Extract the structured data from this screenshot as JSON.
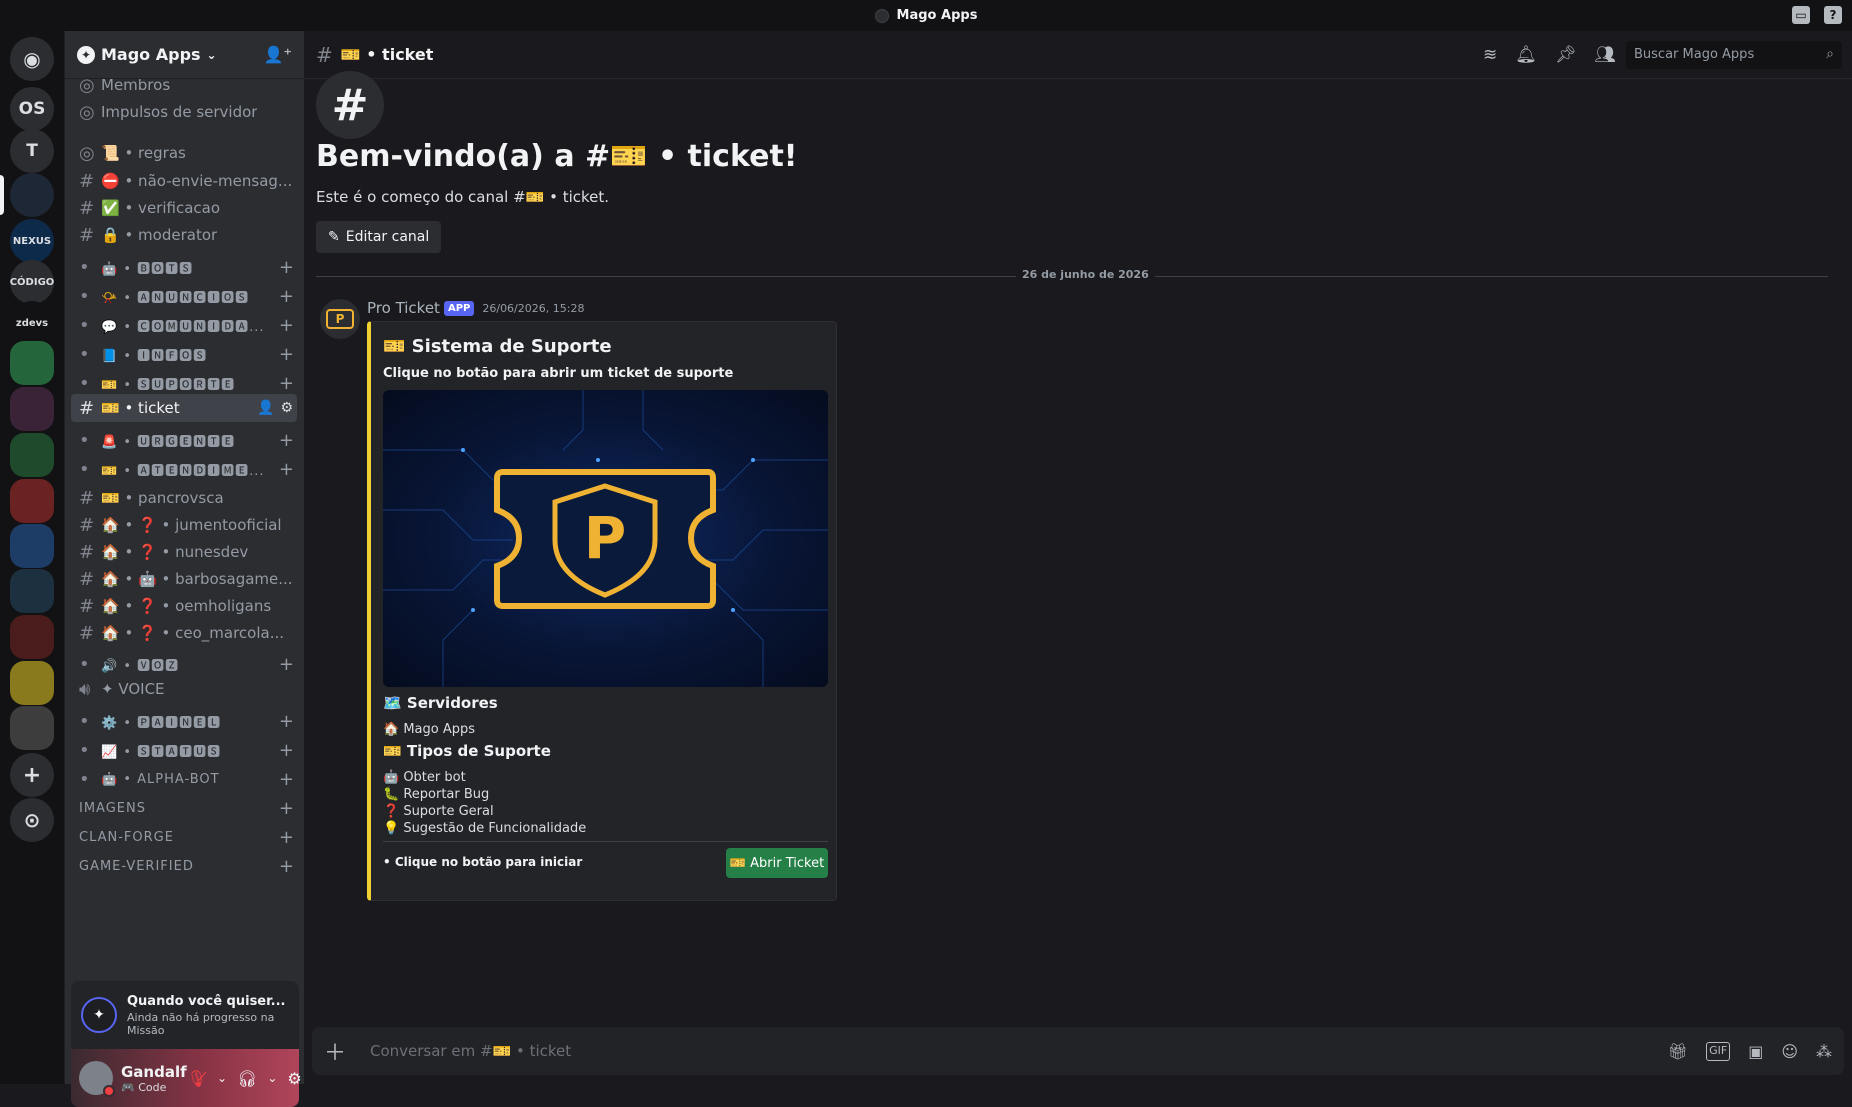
{
  "app": {
    "title": "Mago Apps"
  },
  "servers": {
    "items": [
      {
        "label": "",
        "kind": "home",
        "icon": "discord-logo-icon"
      },
      {
        "label": "OS"
      },
      {
        "label": "T"
      },
      {
        "label": "",
        "icon": "server-avatar",
        "selected": true
      },
      {
        "label": "NEXUS",
        "icon": "server-avatar"
      },
      {
        "label": "CÓDIGO",
        "icon": "server-avatar"
      },
      {
        "label": "zdevs",
        "icon": "server-avatar"
      },
      {
        "label": "",
        "icon": "server-folder"
      },
      {
        "label": "",
        "icon": "server-folder"
      },
      {
        "label": "",
        "icon": "server-folder"
      },
      {
        "label": "",
        "icon": "server-folder"
      },
      {
        "label": "",
        "icon": "server-folder"
      },
      {
        "label": "",
        "icon": "server-folder"
      },
      {
        "label": "",
        "icon": "server-folder"
      },
      {
        "label": "",
        "icon": "server-folder"
      },
      {
        "label": "",
        "icon": "server-folder"
      }
    ],
    "add_label": "+",
    "discover_label": "⊙"
  },
  "sidebar": {
    "guild_name": "Mago Apps",
    "channels": [
      {
        "icon": "members-icon",
        "name": "Membros"
      },
      {
        "icon": "boost-icon",
        "name": "Impulsos de servidor"
      },
      {
        "icon": "rules-icon",
        "name": "📜 • regras"
      },
      {
        "icon": "#",
        "name": "⛔ • não-envie-mensag..."
      },
      {
        "icon": "#",
        "name": "✅ • verificacao"
      },
      {
        "icon": "#",
        "name": "🔒 • moderator"
      },
      {
        "icon": "•",
        "name": "🤖 • 🅱🅾🆃🆂",
        "category": true
      },
      {
        "icon": "•",
        "name": "📯 • 🅰🅽🆄🅽🅲🅸🅾🆂",
        "category": true
      },
      {
        "icon": "•",
        "name": "💬 • 🅲🅾🅼🆄🅽🅸🅳🅰...",
        "category": true
      },
      {
        "icon": "•",
        "name": "📘 • 🅸🅽🅵🅾🆂",
        "category": true
      },
      {
        "icon": "•",
        "name": "🎫 • 🆂🆄🅿🅾🆁🆃🅴",
        "category": true
      },
      {
        "icon": "#",
        "name": "🎫 • ticket",
        "active": true
      },
      {
        "icon": "•",
        "name": "🚨 • 🆄🆁🅶🅴🅽🆃🅴",
        "category": true
      },
      {
        "icon": "•",
        "name": "🎫 • 🅰🆃🅴🅽🅳🅸🅼🅴...",
        "category": true
      },
      {
        "icon": "#",
        "name": "🎫 • pancrovsca"
      },
      {
        "icon": "#",
        "name": "🏠 • ❓ • jumentooficial"
      },
      {
        "icon": "#",
        "name": "🏠 • ❓ • nunesdev"
      },
      {
        "icon": "#",
        "name": "🏠 • 🤖 • barbosagame..."
      },
      {
        "icon": "#",
        "name": "🏠 • ❓ • oemholigans"
      },
      {
        "icon": "#",
        "name": "🏠 • ❓ • ceo_marcola..."
      },
      {
        "icon": "•",
        "name": "🔊 • 🆅🅾🆉",
        "category": true
      },
      {
        "icon": "🔊",
        "name": "✦ VOICE"
      },
      {
        "icon": "•",
        "name": "⚙️ • 🅿🅰🅸🅽🅴🅻",
        "category": true
      },
      {
        "icon": "•",
        "name": "📈 • 🆂🆃🅰🆃🆄🆂",
        "category": true
      },
      {
        "icon": "•",
        "name": "🤖 • ALPHA-BOT",
        "category": true
      },
      {
        "icon": "",
        "name": "IMAGENS",
        "category": true
      },
      {
        "icon": "",
        "name": "CLAN-FORGE",
        "category": true
      },
      {
        "icon": "",
        "name": "GAME-VERIFIED",
        "category": true
      }
    ],
    "mission": {
      "title": "Quando você quiser...",
      "subtitle": "Ainda não há progresso na Missão"
    },
    "user": {
      "name": "Gandalf",
      "status": "🎮 Code"
    }
  },
  "header": {
    "channel_name": "🎫 • ticket",
    "search_placeholder": "Buscar Mago Apps"
  },
  "welcome": {
    "icon": "#",
    "title": "Bem-vindo(a) a #🎫 • ticket!",
    "subtitle": "Este é o começo do canal #🎫 • ticket.",
    "edit_label": "Editar canal"
  },
  "date_divider": "26 de junho de 2026",
  "message": {
    "author": "Pro Ticket",
    "tag": "APP",
    "timestamp": "26/06/2026, 15:28",
    "embed": {
      "title": "🎫 Sistema de Suporte",
      "description": "Clique no botão para abrir um ticket de suporte",
      "field1_title": "🗺️ Servidores",
      "field1_value": "🏠 Mago Apps",
      "field2_title": "🎫 Tipos de Suporte",
      "field2_values": [
        "🤖 Obter bot",
        "🐛 Reportar Bug",
        "❓ Suporte Geral",
        "💡 Sugestão de Funcionalidade"
      ],
      "footer": "• Clique no botão para iniciar",
      "button_label": "🎫 Abrir Ticket",
      "image_letter": "P"
    }
  },
  "composer": {
    "placeholder": "Conversar em #🎫 • ticket"
  },
  "colors": {
    "accent": "#5865f2",
    "embed_bar": "#f0d232",
    "button_green": "#248046",
    "danger": "#f23f43"
  }
}
